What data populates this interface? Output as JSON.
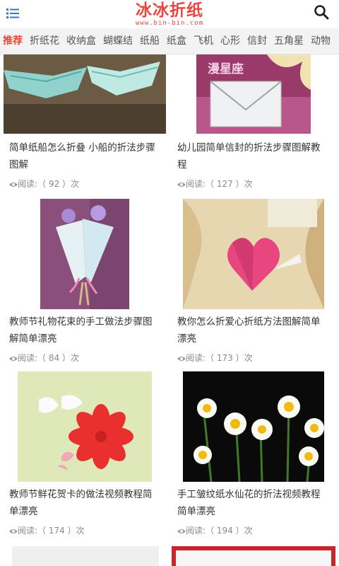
{
  "header": {
    "logo_text": "冰冰折纸",
    "logo_sub": "www.bin-bin.com"
  },
  "nav": {
    "items": [
      "推荐",
      "折纸花",
      "收纳盒",
      "蝴蝶结",
      "纸船",
      "纸盒",
      "飞机",
      "心形",
      "信封",
      "五角星",
      "动物"
    ]
  },
  "articles": [
    {
      "title": "简单纸船怎么折叠 小船的折法步骤图解",
      "reads": "阅读:（ 92 ）次"
    },
    {
      "title": "幼儿园简单信封的折法步骤图解教程",
      "reads": "阅读:（ 127 ）次",
      "image_text": "漫星座"
    },
    {
      "title": "教师节礼物花束的手工做法步骤图解简单漂亮",
      "reads": "阅读:（ 84 ）次"
    },
    {
      "title": "教你怎么折爱心折纸方法图解简单漂亮",
      "reads": "阅读:（ 173 ）次"
    },
    {
      "title": "教师节鲜花贺卡的做法视频教程简单漂亮",
      "reads": "阅读:（ 174 ）次"
    },
    {
      "title": "手工皱纹纸水仙花的折法视频教程简单漂亮",
      "reads": "阅读:（ 194 ）次"
    }
  ],
  "colors": {
    "accent": "#e8463e",
    "nav_bg": "#f3f3f3",
    "meta_text": "#888888"
  }
}
